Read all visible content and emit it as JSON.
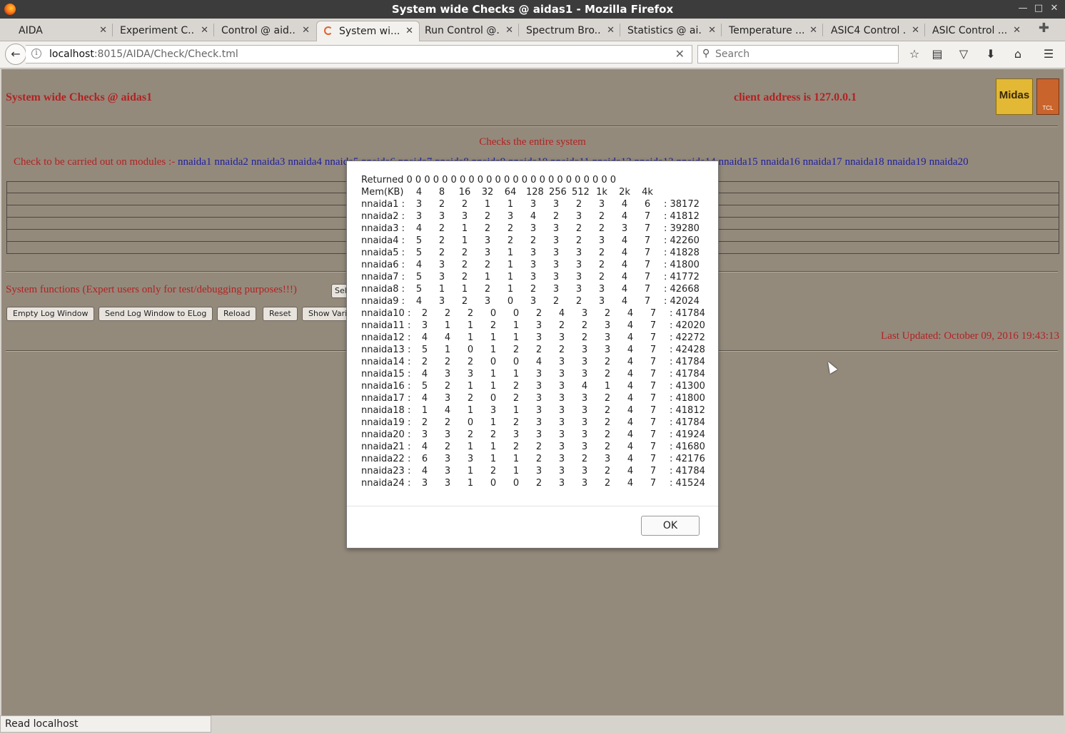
{
  "window": {
    "title": "System wide Checks @ aidas1 - Mozilla Firefox"
  },
  "tabs": [
    {
      "label": "AIDA"
    },
    {
      "label": "Experiment C..."
    },
    {
      "label": "Control @ aid..."
    },
    {
      "label": "System wi..."
    },
    {
      "label": "Run Control @..."
    },
    {
      "label": "Spectrum Bro..."
    },
    {
      "label": "Statistics @ ai..."
    },
    {
      "label": "Temperature ..."
    },
    {
      "label": "ASIC4 Control ..."
    },
    {
      "label": "ASIC Control ..."
    }
  ],
  "nav": {
    "url_host": "localhost",
    "url_rest": ":8015/AIDA/Check/Check.tml",
    "search_placeholder": "Search"
  },
  "page": {
    "title": "System wide Checks @ aidas1",
    "client": "client address is 127.0.0.1",
    "logo_midas": "Midas",
    "logo_tcl": "TCL",
    "checks": "Checks the entire system",
    "modules_label": "Check to be carried out on modules :-",
    "modules": [
      "nnaida1",
      "nnaida2",
      "nnaida3",
      "nnaida4",
      "nnaida5",
      "nnaida6",
      "nnaida7",
      "nnaida8",
      "nnaida9",
      "nnaida10",
      "nnaida11",
      "nnaida12",
      "nnaida13",
      "nnaida14",
      "nnaida15",
      "nnaida16",
      "nnaida17",
      "nnaida18",
      "nnaida19",
      "nnaida20"
    ],
    "sysfn": "System functions (Expert users only for test/debugging purposes!!!)",
    "buttons": {
      "empty": "Empty Log Window",
      "send": "Send Log Window to ELog",
      "reload": "Reload",
      "reset": "Reset",
      "show": "Show Variables",
      "select": "Select"
    },
    "last_updated": "Last Updated: October 09, 2016 19:43:13"
  },
  "dialog": {
    "returned": "Returned 0 0 0 0 0 0 0 0 0 0 0 0 0 0 0 0 0 0 0 0 0 0 0 0",
    "header": [
      "Mem(KB)",
      "4",
      "8",
      "16",
      "32",
      "64",
      "128",
      "256",
      "512",
      "1k",
      "2k",
      "4k"
    ],
    "rows": [
      {
        "name": "nnaida1 :",
        "v": [
          "3",
          "2",
          "2",
          "1",
          "1",
          "3",
          "3",
          "2",
          "3",
          "4",
          "6"
        ],
        "mem": ": 38172"
      },
      {
        "name": "nnaida2 :",
        "v": [
          "3",
          "3",
          "3",
          "2",
          "3",
          "4",
          "2",
          "3",
          "2",
          "4",
          "7"
        ],
        "mem": ": 41812"
      },
      {
        "name": "nnaida3 :",
        "v": [
          "4",
          "2",
          "1",
          "2",
          "2",
          "3",
          "3",
          "2",
          "2",
          "3",
          "7"
        ],
        "mem": ": 39280"
      },
      {
        "name": "nnaida4 :",
        "v": [
          "5",
          "2",
          "1",
          "3",
          "2",
          "2",
          "3",
          "2",
          "3",
          "4",
          "7"
        ],
        "mem": ": 42260"
      },
      {
        "name": "nnaida5 :",
        "v": [
          "5",
          "2",
          "2",
          "3",
          "1",
          "3",
          "3",
          "3",
          "2",
          "4",
          "7"
        ],
        "mem": ": 41828"
      },
      {
        "name": "nnaida6 :",
        "v": [
          "4",
          "3",
          "2",
          "2",
          "1",
          "3",
          "3",
          "3",
          "2",
          "4",
          "7"
        ],
        "mem": ": 41800"
      },
      {
        "name": "nnaida7 :",
        "v": [
          "5",
          "3",
          "2",
          "1",
          "1",
          "3",
          "3",
          "3",
          "2",
          "4",
          "7"
        ],
        "mem": ": 41772"
      },
      {
        "name": "nnaida8 :",
        "v": [
          "5",
          "1",
          "1",
          "2",
          "1",
          "2",
          "3",
          "3",
          "3",
          "4",
          "7"
        ],
        "mem": ": 42668"
      },
      {
        "name": "nnaida9 :",
        "v": [
          "4",
          "3",
          "2",
          "3",
          "0",
          "3",
          "2",
          "2",
          "3",
          "4",
          "7"
        ],
        "mem": ": 42024"
      },
      {
        "name": "nnaida10 :",
        "v": [
          "2",
          "2",
          "2",
          "0",
          "0",
          "2",
          "4",
          "3",
          "2",
          "4",
          "7"
        ],
        "mem": ": 41784"
      },
      {
        "name": "nnaida11 :",
        "v": [
          "3",
          "1",
          "1",
          "2",
          "1",
          "3",
          "2",
          "2",
          "3",
          "4",
          "7"
        ],
        "mem": ": 42020"
      },
      {
        "name": "nnaida12 :",
        "v": [
          "4",
          "4",
          "1",
          "1",
          "1",
          "3",
          "3",
          "2",
          "3",
          "4",
          "7"
        ],
        "mem": ": 42272"
      },
      {
        "name": "nnaida13 :",
        "v": [
          "5",
          "1",
          "0",
          "1",
          "2",
          "2",
          "2",
          "3",
          "3",
          "4",
          "7"
        ],
        "mem": ": 42428"
      },
      {
        "name": "nnaida14 :",
        "v": [
          "2",
          "2",
          "2",
          "0",
          "0",
          "4",
          "3",
          "3",
          "2",
          "4",
          "7"
        ],
        "mem": ": 41784"
      },
      {
        "name": "nnaida15 :",
        "v": [
          "4",
          "3",
          "3",
          "1",
          "1",
          "3",
          "3",
          "3",
          "2",
          "4",
          "7"
        ],
        "mem": ": 41784"
      },
      {
        "name": "nnaida16 :",
        "v": [
          "5",
          "2",
          "1",
          "1",
          "2",
          "3",
          "3",
          "4",
          "1",
          "4",
          "7"
        ],
        "mem": ": 41300"
      },
      {
        "name": "nnaida17 :",
        "v": [
          "4",
          "3",
          "2",
          "0",
          "2",
          "3",
          "3",
          "3",
          "2",
          "4",
          "7"
        ],
        "mem": ": 41800"
      },
      {
        "name": "nnaida18 :",
        "v": [
          "1",
          "4",
          "1",
          "3",
          "1",
          "3",
          "3",
          "3",
          "2",
          "4",
          "7"
        ],
        "mem": ": 41812"
      },
      {
        "name": "nnaida19 :",
        "v": [
          "2",
          "2",
          "0",
          "1",
          "2",
          "3",
          "3",
          "3",
          "2",
          "4",
          "7"
        ],
        "mem": ": 41784"
      },
      {
        "name": "nnaida20 :",
        "v": [
          "3",
          "3",
          "2",
          "2",
          "3",
          "3",
          "3",
          "3",
          "2",
          "4",
          "7"
        ],
        "mem": ": 41924"
      },
      {
        "name": "nnaida21 :",
        "v": [
          "4",
          "2",
          "1",
          "1",
          "2",
          "2",
          "3",
          "3",
          "2",
          "4",
          "7"
        ],
        "mem": ": 41680"
      },
      {
        "name": "nnaida22 :",
        "v": [
          "6",
          "3",
          "3",
          "1",
          "1",
          "2",
          "3",
          "2",
          "3",
          "4",
          "7"
        ],
        "mem": ": 42176"
      },
      {
        "name": "nnaida23 :",
        "v": [
          "4",
          "3",
          "1",
          "2",
          "1",
          "3",
          "3",
          "3",
          "2",
          "4",
          "7"
        ],
        "mem": ": 41784"
      },
      {
        "name": "nnaida24 :",
        "v": [
          "3",
          "3",
          "1",
          "0",
          "0",
          "2",
          "3",
          "3",
          "2",
          "4",
          "7"
        ],
        "mem": ": 41524"
      }
    ],
    "ok": "OK"
  },
  "status": "Read localhost"
}
